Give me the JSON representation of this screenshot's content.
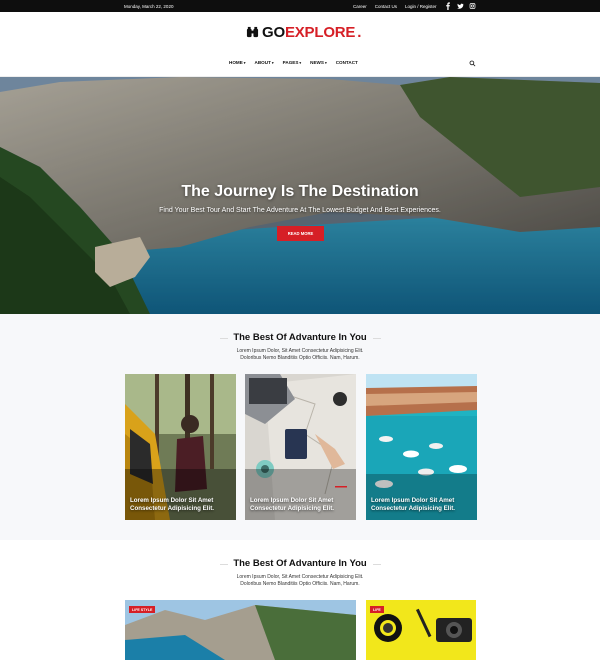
{
  "topbar": {
    "date": "Monday, March 22, 2020",
    "links": [
      "Career",
      "Contact Us",
      "Login / Register"
    ],
    "social_icons": [
      "facebook-icon",
      "twitter-icon",
      "instagram-icon"
    ]
  },
  "brand": {
    "name_part1": "GO",
    "name_part2": "EXPLORE",
    "dot": ".",
    "accent": "#d61f26"
  },
  "nav": {
    "items": [
      "HOME",
      "ABOUT",
      "PAGES",
      "NEWS",
      "CONTACT"
    ],
    "dropdown": [
      true,
      true,
      true,
      true,
      false
    ],
    "search_icon": "search-icon"
  },
  "hero": {
    "title": "The Journey Is The Destination",
    "subtitle": "Find Your Best Tour And Start The Adventure At The Lowest Budget And Best Experiences.",
    "button": "READ MORE"
  },
  "section1": {
    "title": "The Best Of Advanture In You",
    "desc_line1": "Lorem Ipsum Dolor, Sit Amet Consectetur Adipisicing Elit.",
    "desc_line2": "Doloribus Nemo Blanditiis Optio Officiis. Nam, Harum.",
    "cards": [
      {
        "line1": "Lorem Ipsum Dolor Sit Amet",
        "line2": "Consectetur Adipisicing Elit."
      },
      {
        "line1": "Lorem Ipsum Dolor Sit Amet",
        "line2": "Consectetur Adipisicing Elit."
      },
      {
        "line1": "Lorem Ipsum Dolor Sit Amet",
        "line2": "Consectetur Adipisicing Elit."
      }
    ]
  },
  "section2": {
    "title": "The Best Of Advanture In You",
    "desc_line1": "Lorem Ipsum Dolor, Sit Amet Consectetur Adipisicing Elit.",
    "desc_line2": "Doloribus Nemo Blanditiis Optio Officiis. Nam, Harum.",
    "tag1": "LIFE STYLE",
    "tag2": "LIFE"
  }
}
